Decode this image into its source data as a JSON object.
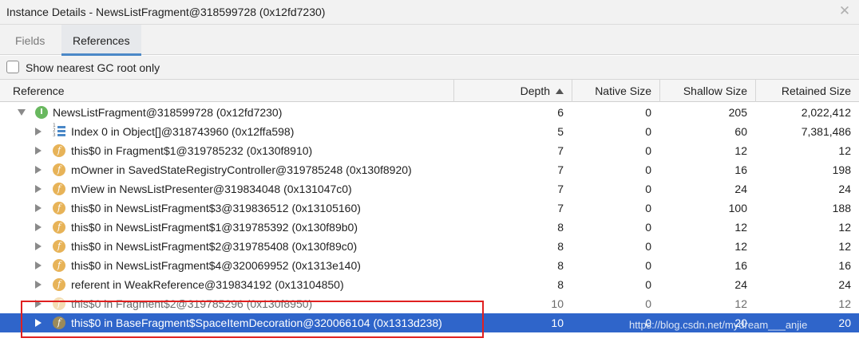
{
  "window": {
    "title": "Instance Details - NewsListFragment@318599728 (0x12fd7230)",
    "close_glyph": "✕"
  },
  "tabs": [
    {
      "label": "Fields",
      "active": false
    },
    {
      "label": "References",
      "active": true
    }
  ],
  "gc_option": {
    "label": "Show nearest GC root only",
    "checked": false
  },
  "columns": {
    "reference": "Reference",
    "depth": "Depth",
    "native": "Native Size",
    "shallow": "Shallow Size",
    "retained": "Retained Size",
    "sort_column": "Depth",
    "sort_direction": "ascending"
  },
  "rows": [
    {
      "name": "NewsListFragment@318599728 (0x12fd7230)",
      "icon": "instance-icon",
      "icon_glyph": "I",
      "expanded": true,
      "depth": "6",
      "native": "0",
      "shallow": "205",
      "retained": "2,022,412"
    },
    {
      "name": "Index 0 in Object[]@318743960 (0x12ffa598)",
      "icon": "array-icon",
      "icon_glyph": "",
      "expanded": false,
      "depth": "5",
      "native": "0",
      "shallow": "60",
      "retained": "7,381,486"
    },
    {
      "name": "this$0 in Fragment$1@319785232 (0x130f8910)",
      "icon": "field-icon",
      "icon_glyph": "f",
      "expanded": false,
      "depth": "7",
      "native": "0",
      "shallow": "12",
      "retained": "12"
    },
    {
      "name": "mOwner in SavedStateRegistryController@319785248 (0x130f8920)",
      "icon": "field-icon",
      "icon_glyph": "f",
      "expanded": false,
      "depth": "7",
      "native": "0",
      "shallow": "16",
      "retained": "198"
    },
    {
      "name": "mView in NewsListPresenter@319834048 (0x131047c0)",
      "icon": "field-icon",
      "icon_glyph": "f",
      "expanded": false,
      "depth": "7",
      "native": "0",
      "shallow": "24",
      "retained": "24"
    },
    {
      "name": "this$0 in NewsListFragment$3@319836512 (0x13105160)",
      "icon": "field-icon",
      "icon_glyph": "f",
      "expanded": false,
      "depth": "7",
      "native": "0",
      "shallow": "100",
      "retained": "188"
    },
    {
      "name": "this$0 in NewsListFragment$1@319785392 (0x130f89b0)",
      "icon": "field-icon",
      "icon_glyph": "f",
      "expanded": false,
      "depth": "8",
      "native": "0",
      "shallow": "12",
      "retained": "12"
    },
    {
      "name": "this$0 in NewsListFragment$2@319785408 (0x130f89c0)",
      "icon": "field-icon",
      "icon_glyph": "f",
      "expanded": false,
      "depth": "8",
      "native": "0",
      "shallow": "12",
      "retained": "12"
    },
    {
      "name": "this$0 in NewsListFragment$4@320069952 (0x1313e140)",
      "icon": "field-icon",
      "icon_glyph": "f",
      "expanded": false,
      "depth": "8",
      "native": "0",
      "shallow": "16",
      "retained": "16"
    },
    {
      "name": "referent in WeakReference@319834192 (0x13104850)",
      "icon": "field-icon",
      "icon_glyph": "f",
      "expanded": false,
      "depth": "8",
      "native": "0",
      "shallow": "24",
      "retained": "24"
    },
    {
      "name": "this$0 in Fragment$2@319785296 (0x130f8950)",
      "icon": "field-icon",
      "icon_glyph": "f",
      "expanded": false,
      "depth": "10",
      "native": "0",
      "shallow": "12",
      "retained": "12"
    },
    {
      "name": "this$0 in BaseFragment$SpaceItemDecoration@320066104 (0x1313d238)",
      "icon": "field-icon",
      "icon_glyph": "f",
      "expanded": false,
      "selected": true,
      "depth": "10",
      "native": "0",
      "shallow": "20",
      "retained": "20"
    }
  ],
  "watermark": "https://blog.csdn.net/mydream___anjie",
  "colors": {
    "selection": "#2f65ca",
    "highlight_box": "#e02020",
    "field_icon": "#e7b358",
    "instance_icon": "#69b85f",
    "tab_underline": "#4a88c7"
  }
}
